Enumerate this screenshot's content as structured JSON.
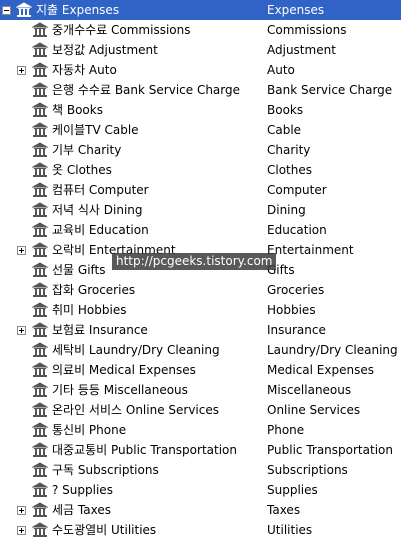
{
  "tree": {
    "root": {
      "label": "지출 Expenses",
      "value": "Expenses"
    },
    "children": [
      {
        "label": "중개수수료 Commissions",
        "value": "Commissions",
        "expandable": false
      },
      {
        "label": "보정값 Adjustment",
        "value": "Adjustment",
        "expandable": false
      },
      {
        "label": "자동차 Auto",
        "value": "Auto",
        "expandable": true
      },
      {
        "label": "은행 수수료 Bank Service Charge",
        "value": "Bank Service Charge",
        "expandable": false
      },
      {
        "label": "책 Books",
        "value": "Books",
        "expandable": false
      },
      {
        "label": "케이블TV Cable",
        "value": "Cable",
        "expandable": false
      },
      {
        "label": "기부 Charity",
        "value": "Charity",
        "expandable": false
      },
      {
        "label": "옷 Clothes",
        "value": "Clothes",
        "expandable": false
      },
      {
        "label": "컴퓨터 Computer",
        "value": "Computer",
        "expandable": false
      },
      {
        "label": "저녁 식사 Dining",
        "value": "Dining",
        "expandable": false
      },
      {
        "label": "교육비 Education",
        "value": "Education",
        "expandable": false
      },
      {
        "label": "오락비 Entertainment",
        "value": "Entertainment",
        "expandable": true
      },
      {
        "label": "선물 Gifts",
        "value": "Gifts",
        "expandable": false
      },
      {
        "label": "잡화 Groceries",
        "value": "Groceries",
        "expandable": false
      },
      {
        "label": "취미 Hobbies",
        "value": "Hobbies",
        "expandable": false
      },
      {
        "label": "보험료 Insurance",
        "value": "Insurance",
        "expandable": true
      },
      {
        "label": "세탁비 Laundry/Dry Cleaning",
        "value": "Laundry/Dry Cleaning",
        "expandable": false
      },
      {
        "label": "의료비 Medical Expenses",
        "value": "Medical Expenses",
        "expandable": false
      },
      {
        "label": "기타 등등 Miscellaneous",
        "value": "Miscellaneous",
        "expandable": false
      },
      {
        "label": "온라인 서비스 Online Services",
        "value": "Online Services",
        "expandable": false
      },
      {
        "label": "통신비 Phone",
        "value": "Phone",
        "expandable": false
      },
      {
        "label": "대중교통비 Public Transportation",
        "value": "Public Transportation",
        "expandable": false
      },
      {
        "label": "구독 Subscriptions",
        "value": "Subscriptions",
        "expandable": false
      },
      {
        "label": "? Supplies",
        "value": "Supplies",
        "expandable": false
      },
      {
        "label": "세금 Taxes",
        "value": "Taxes",
        "expandable": true
      },
      {
        "label": "수도광열비 Utilities",
        "value": "Utilities",
        "expandable": true
      }
    ]
  },
  "watermark": "http://pcgeeks.tistory.com",
  "icon": "bank-building-icon",
  "colors": {
    "selection": "#3163c6",
    "icon": "#555555"
  }
}
